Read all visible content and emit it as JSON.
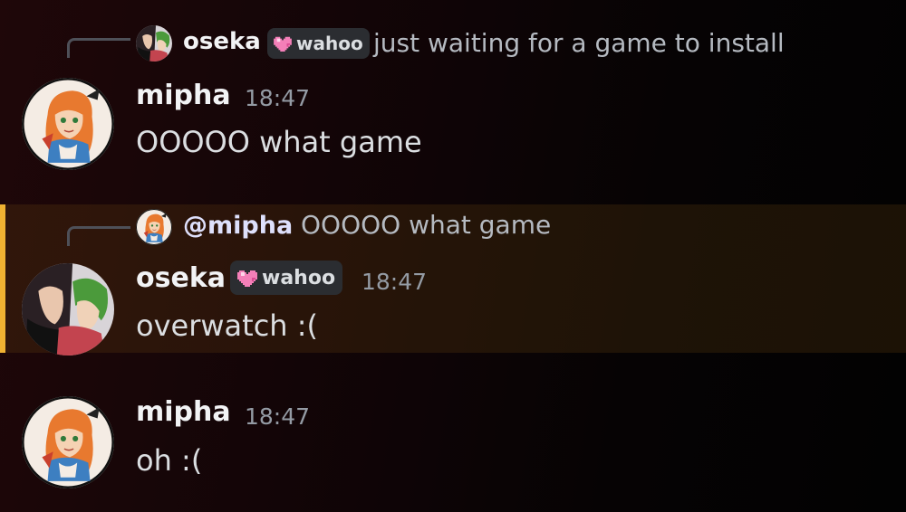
{
  "messages": [
    {
      "reply": {
        "author": "oseka",
        "tag": "wahoo",
        "text": "just waiting for a game to install"
      },
      "author": "mipha",
      "time": "18:47",
      "text": "OOOOO what game"
    },
    {
      "reply": {
        "author": "@mipha",
        "text": "OOOOO what game"
      },
      "author": "oseka",
      "tag": "wahoo",
      "time": "18:47",
      "text": "overwatch :("
    },
    {
      "author": "mipha",
      "time": "18:47",
      "text": "oh :("
    }
  ],
  "colors": {
    "highlight_bar": "#f0b232",
    "username": "#f2f3f5",
    "timestamp": "#949ba4",
    "message_text": "#dbdee1",
    "reply_preview": "#b5bac1",
    "tag_background": "#2b2d31",
    "heart": "#f47fb8"
  },
  "icons": {
    "tag_icon": "pixel-heart-icon"
  }
}
